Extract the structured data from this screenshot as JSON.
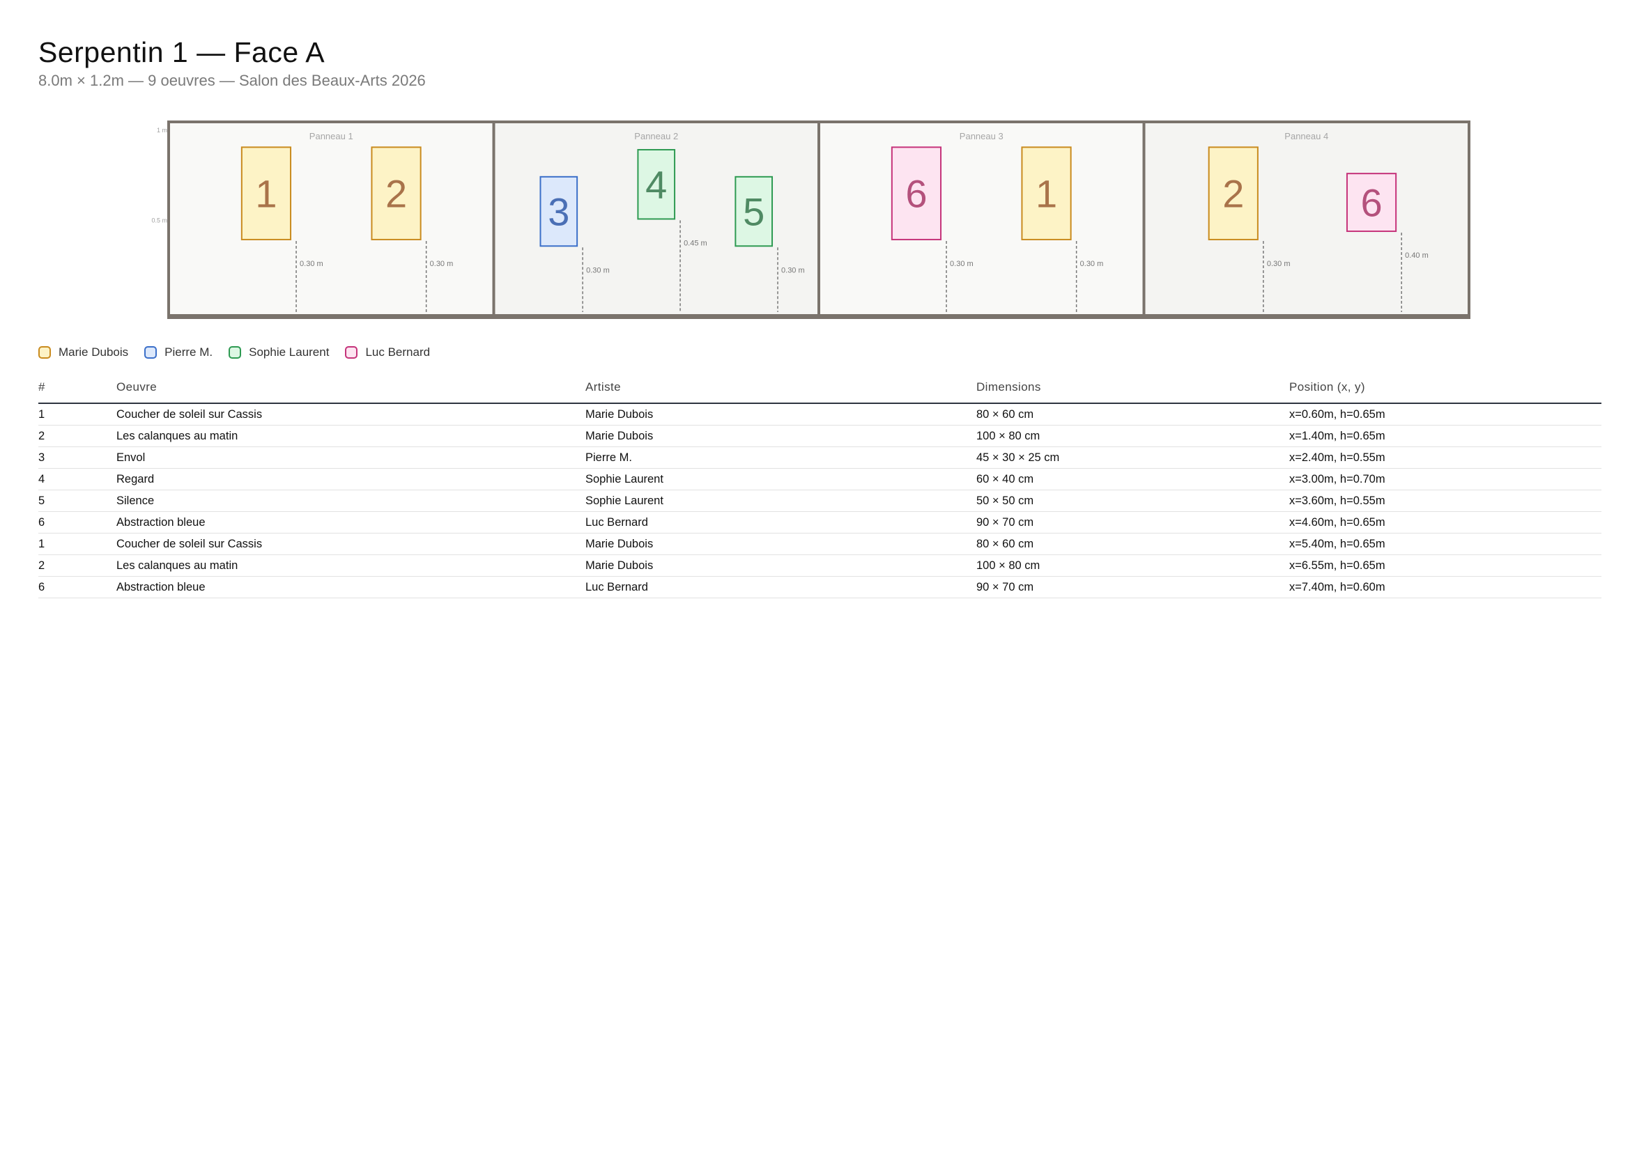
{
  "header": {
    "title": "Serpentin 1 — Face A",
    "subtitle": "8.0m × 1.2m — 9 oeuvres — Salon des Beaux-Arts 2026"
  },
  "colors": {
    "wall_border": "#7a736c",
    "Marie Dubois": {
      "stroke": "#c98b1e",
      "fill": "#fdf3c6",
      "text": "#a9734a"
    },
    "Pierre M.": {
      "stroke": "#3b6fc9",
      "fill": "#dce8fb",
      "text": "#4a6fb5"
    },
    "Sophie Laurent": {
      "stroke": "#2e9a52",
      "fill": "#ddf7e4",
      "text": "#4f8a63"
    },
    "Luc Bernard": {
      "stroke": "#c5337a",
      "fill": "#fde4f1",
      "text": "#b4517c"
    }
  },
  "wall": {
    "width_m": 8.0,
    "height_m": 1.2,
    "y_ticks": [
      {
        "label": "1 m",
        "value": 1.0
      },
      {
        "label": "0.5 m",
        "value": 0.5
      }
    ],
    "panels": [
      {
        "label": "Panneau 1"
      },
      {
        "label": "Panneau 2"
      },
      {
        "label": "Panneau 3"
      },
      {
        "label": "Panneau 4"
      }
    ],
    "artworks": [
      {
        "number": "1",
        "artist": "Marie Dubois",
        "x_m": 0.6,
        "h_m": 0.65,
        "w_cm": 60,
        "ht_cm": 80,
        "gap_label": "0.30 m"
      },
      {
        "number": "2",
        "artist": "Marie Dubois",
        "x_m": 1.4,
        "h_m": 0.65,
        "w_cm": 60,
        "ht_cm": 80,
        "gap_label": "0.30 m"
      },
      {
        "number": "3",
        "artist": "Pierre M.",
        "x_m": 2.4,
        "h_m": 0.55,
        "w_cm": 45,
        "ht_cm": 60,
        "gap_label": "0.30 m"
      },
      {
        "number": "4",
        "artist": "Sophie Laurent",
        "x_m": 3.0,
        "h_m": 0.7,
        "w_cm": 45,
        "ht_cm": 60,
        "gap_label": "0.45 m"
      },
      {
        "number": "5",
        "artist": "Sophie Laurent",
        "x_m": 3.6,
        "h_m": 0.55,
        "w_cm": 45,
        "ht_cm": 60,
        "gap_label": "0.30 m"
      },
      {
        "number": "6",
        "artist": "Luc Bernard",
        "x_m": 4.6,
        "h_m": 0.65,
        "w_cm": 60,
        "ht_cm": 80,
        "gap_label": "0.30 m"
      },
      {
        "number": "1",
        "artist": "Marie Dubois",
        "x_m": 5.4,
        "h_m": 0.65,
        "w_cm": 60,
        "ht_cm": 80,
        "gap_label": "0.30 m"
      },
      {
        "number": "2",
        "artist": "Marie Dubois",
        "x_m": 6.55,
        "h_m": 0.65,
        "w_cm": 60,
        "ht_cm": 80,
        "gap_label": "0.30 m"
      },
      {
        "number": "6",
        "artist": "Luc Bernard",
        "x_m": 7.4,
        "h_m": 0.6,
        "w_cm": 60,
        "ht_cm": 50,
        "gap_label": "0.40 m"
      }
    ]
  },
  "legend": [
    {
      "label": "Marie Dubois"
    },
    {
      "label": "Pierre M."
    },
    {
      "label": "Sophie Laurent"
    },
    {
      "label": "Luc Bernard"
    }
  ],
  "table": {
    "headers": [
      "#",
      "Oeuvre",
      "Artiste",
      "Dimensions",
      "Position (x, y)"
    ],
    "rows": [
      [
        "1",
        "Coucher de soleil sur Cassis",
        "Marie Dubois",
        "80 × 60 cm",
        "x=0.60m, h=0.65m"
      ],
      [
        "2",
        "Les calanques au matin",
        "Marie Dubois",
        "100 × 80 cm",
        "x=1.40m, h=0.65m"
      ],
      [
        "3",
        "Envol",
        "Pierre M.",
        "45 × 30 × 25 cm",
        "x=2.40m, h=0.55m"
      ],
      [
        "4",
        "Regard",
        "Sophie Laurent",
        "60 × 40 cm",
        "x=3.00m, h=0.70m"
      ],
      [
        "5",
        "Silence",
        "Sophie Laurent",
        "50 × 50 cm",
        "x=3.60m, h=0.55m"
      ],
      [
        "6",
        "Abstraction bleue",
        "Luc Bernard",
        "90 × 70 cm",
        "x=4.60m, h=0.65m"
      ],
      [
        "1",
        "Coucher de soleil sur Cassis",
        "Marie Dubois",
        "80 × 60 cm",
        "x=5.40m, h=0.65m"
      ],
      [
        "2",
        "Les calanques au matin",
        "Marie Dubois",
        "100 × 80 cm",
        "x=6.55m, h=0.65m"
      ],
      [
        "6",
        "Abstraction bleue",
        "Luc Bernard",
        "90 × 70 cm",
        "x=7.40m, h=0.60m"
      ]
    ]
  }
}
